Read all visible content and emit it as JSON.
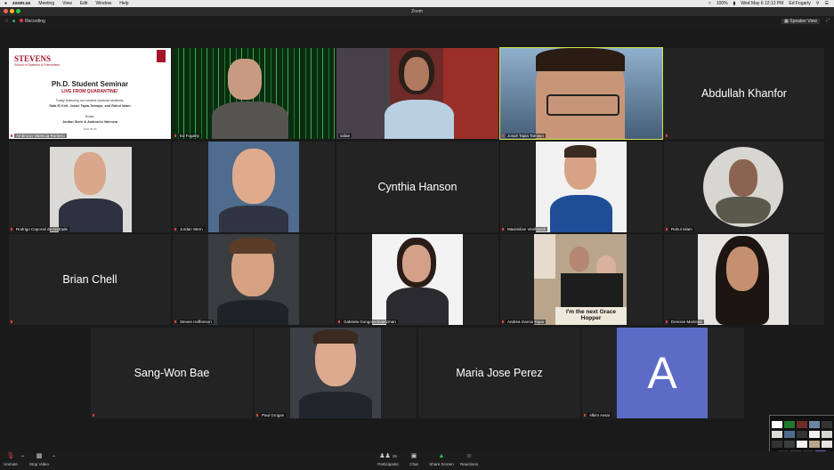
{
  "menubar": {
    "apple": "",
    "app": "zoom.us",
    "items": [
      "Meeting",
      "View",
      "Edit",
      "Window",
      "Help"
    ],
    "battery": "100%",
    "datetime": "Wed May 6  12:12 PM",
    "user": "Ed Fogarty"
  },
  "window": {
    "title": "Zoom"
  },
  "topbar": {
    "recording_label": "Recording",
    "speaker_view_label": "Speaker View"
  },
  "slide": {
    "logo": "STEVENS",
    "school": "School of Systems & Enterprises",
    "title": "Ph.D. Student Seminar",
    "subtitle": "LIVE FROM QUARANTINE!",
    "line1": "Today featuring our newest doctoral students:",
    "line2": "Safa El Kefi, Josué Tapia-Tamayo, and Rahul Islam",
    "hosts_label": "Hosts:",
    "hosts": "Jordan Stern & Ambrocio Valencia",
    "date": "2020.05.06"
  },
  "participants": [
    {
      "name": "Ambrocio Valencia-Romero",
      "big": ""
    },
    {
      "name": "Ed Fogarty",
      "big": ""
    },
    {
      "name": "safae",
      "big": ""
    },
    {
      "name": "Josué Tapia Tamayo",
      "big": ""
    },
    {
      "name": "",
      "big": "Abdullah Khanfor"
    },
    {
      "name": "Rodrigo Caporali de Andrade",
      "big": ""
    },
    {
      "name": "Jordan Stern",
      "big": ""
    },
    {
      "name": "",
      "big": "Cynthia Hanson"
    },
    {
      "name": "Maximilian Vierlboeck",
      "big": ""
    },
    {
      "name": "Rahul Islam",
      "big": ""
    },
    {
      "name": "",
      "big": "Brian Chell"
    },
    {
      "name": "Steven Hoffenson",
      "big": ""
    },
    {
      "name": "Gabriela Gongora-Svartzman",
      "big": ""
    },
    {
      "name": "Andrea Garcia Tapia",
      "big": ""
    },
    {
      "name": "Denisse Martinez",
      "big": ""
    },
    {
      "name": "",
      "big": "Sang-Won Bae"
    },
    {
      "name": "Paul Grogan",
      "big": ""
    },
    {
      "name": "",
      "big": "Maria Jose Perez"
    },
    {
      "name": "Alkim Avsar",
      "big": ""
    }
  ],
  "avatar_letter": "A",
  "poster_text": "I'm the next Grace Hopper",
  "toolbar": {
    "unmute": "Unmute",
    "stop_video": "Stop Video",
    "participants": "Participants",
    "participants_count": "19",
    "chat": "Chat",
    "share_screen": "Share Screen",
    "reactions": "Reactions"
  },
  "colors": {
    "stevens_red": "#a3152b",
    "active_speaker": "#d4e64a",
    "share_green": "#23c552",
    "avatar_blue": "#5b6bc6"
  }
}
